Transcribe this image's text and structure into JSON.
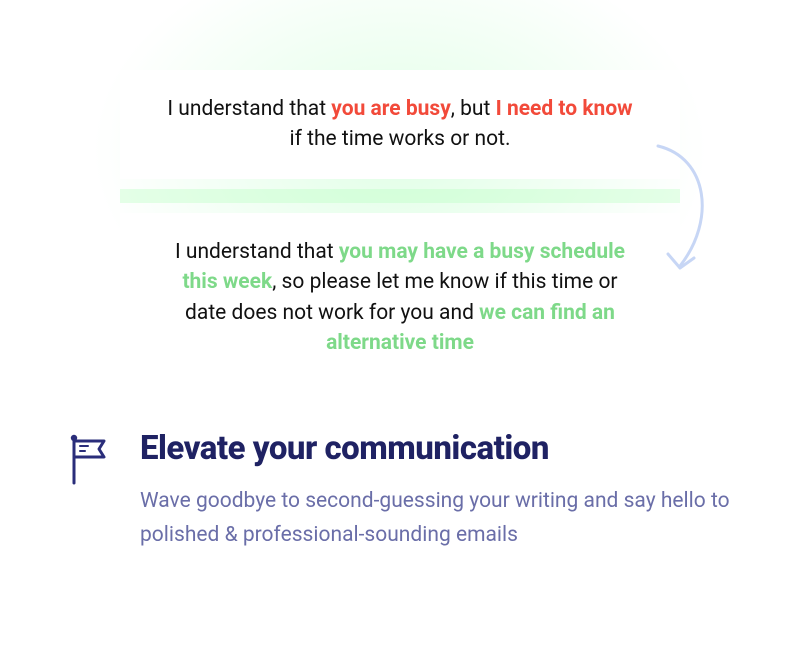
{
  "before": {
    "part1": "I understand that ",
    "hl1": "you are busy",
    "part2": ", but ",
    "hl2": "I need to know",
    "part3": " if the time works or not."
  },
  "after": {
    "part1": "I understand that ",
    "hl1": "you may have a busy schedule this week",
    "part2": ", so please let me know if this time or date does not work for you and ",
    "hl2": "we can find an alternative time"
  },
  "feature": {
    "title": "Elevate your communication",
    "description": "Wave goodbye to second-guessing your writing and say hello to polished & professional-sounding emails"
  },
  "colors": {
    "red": "#f24a3a",
    "green": "#7ed989",
    "heading": "#1f2263",
    "body": "#6a6ea8"
  }
}
